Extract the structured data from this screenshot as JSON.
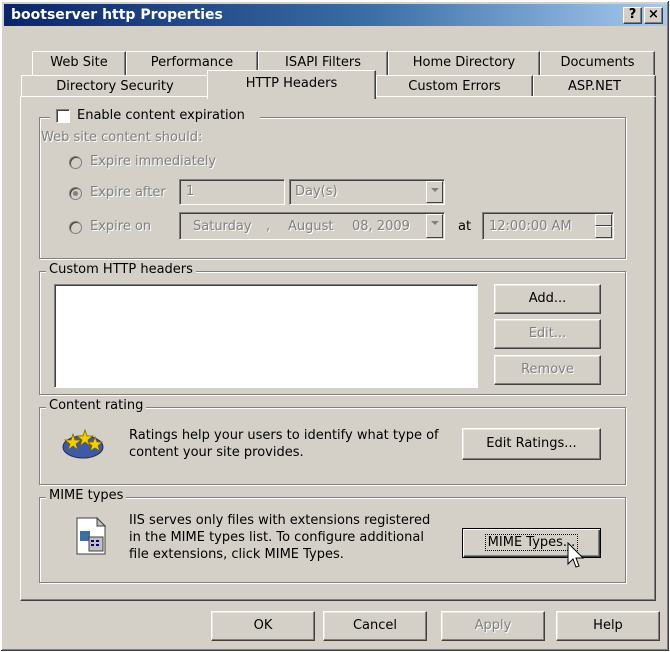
{
  "window": {
    "title": "bootserver http Properties"
  },
  "caption_buttons": {
    "help": "?",
    "close": "×"
  },
  "tabs_row1": [
    "Web Site",
    "Performance",
    "ISAPI Filters",
    "Home Directory",
    "Documents"
  ],
  "tabs_row2": [
    "Directory Security",
    "HTTP Headers",
    "Custom Errors",
    "ASP.NET"
  ],
  "selected_tab": "HTTP Headers",
  "expiration": {
    "enable_label": "Enable content expiration",
    "enabled": false,
    "should_label": "Web site content should:",
    "immediately_label": "Expire immediately",
    "after_label": "Expire after",
    "after_value": "1",
    "after_unit": "Day(s)",
    "on_label": "Expire on",
    "on_day": "Saturday",
    "on_sep": ",",
    "on_month": "August",
    "on_date": "08, 2009",
    "at_label": "at",
    "time_value": "12:00:00 AM"
  },
  "custom_headers": {
    "legend": "Custom HTTP headers",
    "add_label": "Add...",
    "edit_label": "Edit...",
    "remove_label": "Remove"
  },
  "content_rating": {
    "legend": "Content rating",
    "text_line1": "Ratings help your users to identify what type of",
    "text_line2": "content your site provides.",
    "edit_ratings_label": "Edit Ratings..."
  },
  "mime": {
    "legend": "MIME types",
    "text_line1": "IIS serves only files with extensions registered",
    "text_line2": "in the MIME types list. To configure additional",
    "text_line3": "file extensions, click MIME Types.",
    "mime_types_label": "MIME Types..."
  },
  "footer": {
    "ok": "OK",
    "cancel": "Cancel",
    "apply": "Apply",
    "help": "Help"
  }
}
